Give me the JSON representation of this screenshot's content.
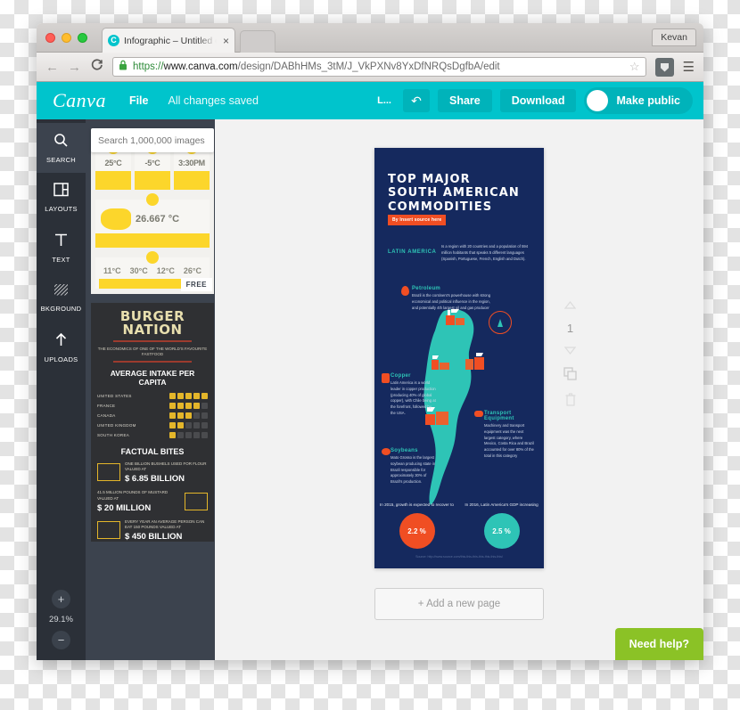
{
  "browser": {
    "tab": {
      "title": "Infographic – Untitled desi",
      "close": "×",
      "favicon_letter": "C"
    },
    "user": "Kevan",
    "nav": {
      "back": "←",
      "forward": "→",
      "reload": "C"
    },
    "url": {
      "scheme": "https://",
      "host": "www.canva.com",
      "path": "/design/DABhHMs_3tM/J_VkPXNv8YxDfNRQsDgfbA/edit",
      "full": "https://www.canva.com/design/DABhHMs_3tM/J_VkPXNv8YxDfNRQsDgfbA/edit"
    },
    "star": "☆",
    "menu": "☰"
  },
  "topbar": {
    "logo": "Canva",
    "file_label": "File",
    "saved_label": "All changes saved",
    "layout_label": "L...",
    "undo_label": "↶",
    "share_label": "Share",
    "download_label": "Download",
    "make_public_label": "Make public",
    "accent_color": "#00c4cc"
  },
  "rail": {
    "items": [
      {
        "label": "SEARCH",
        "icon": "search-icon",
        "active": true
      },
      {
        "label": "LAYOUTS",
        "icon": "layouts-icon",
        "active": false
      },
      {
        "label": "TEXT",
        "icon": "text-icon",
        "active": false
      },
      {
        "label": "BKGROUND",
        "icon": "background-icon",
        "active": false
      },
      {
        "label": "UPLOADS",
        "icon": "uploads-icon",
        "active": false
      }
    ],
    "zoom_in": "+",
    "zoom_out": "−",
    "zoom_value": "29.1%"
  },
  "panel": {
    "search_placeholder": "Search 1,000,000 images",
    "search_value": "",
    "free_badge": "FREE",
    "thumb_weather": {
      "cards": [
        {
          "temp": "25°C"
        },
        {
          "temp": "-5°C"
        },
        {
          "temp": "3:30PM"
        }
      ],
      "big_temp": "26.667 °C",
      "bottom_temps": [
        "11°C",
        "30°C",
        "12°C",
        "26°C"
      ]
    },
    "thumb_burger": {
      "title_line1": "BURGER",
      "title_line2": "NATION",
      "subtitle": "THE ECONOMICS OF ONE OF THE WORLD'S FAVOURITE FASTFOOD",
      "section1": "AVERAGE INTAKE PER CAPITA",
      "countries": [
        {
          "name": "UNITED STATES",
          "filled": 5
        },
        {
          "name": "FRANCE",
          "filled": 4
        },
        {
          "name": "CANADA",
          "filled": 3
        },
        {
          "name": "UNITED KINGDOM",
          "filled": 2
        },
        {
          "name": "SOUTH KOREA",
          "filled": 1
        }
      ],
      "section2": "FACTUAL BITES",
      "facts": [
        {
          "small": "ONE BILLION BUSHELS USED FOR FLOUR VALUED AT",
          "big": "$ 6.85 BILLION"
        },
        {
          "small": "41.5 MILLION POUNDS OF MUSTARD VALUED AT",
          "big": "$ 20 MILLION"
        },
        {
          "small": "EVERY YEAR AN AVERAGE PERSON CAN EAT 150 POUNDS VALUED AT",
          "big": "$ 450 BILLION"
        }
      ]
    }
  },
  "design": {
    "title_line1": "TOP MAJOR",
    "title_line2": "SOUTH AMERICAN",
    "title_line3": "COMMODITIES",
    "source_badge": "By Insert source here",
    "latin_america_heading": "LATIN AMERICA",
    "latin_america_body": "Is a region with 20 countries and a population of 594 million habitants that speaks 5 different languages (Spanish, Portuguese, French, English and Dutch).",
    "sections": [
      {
        "heading": "Petroleum",
        "body": "Brazil is the continent's powerhouse with strong economical and political influence in the region, and potentially 4th largest oil and gas producer",
        "highlight": "4th largest"
      },
      {
        "heading": "Copper",
        "body": "Latin America is a world leader in copper production (producing 40% of global copper), with Chile being at the forefront, followed by the USA.",
        "highlight": "40%"
      },
      {
        "heading": "Transport Equipment",
        "body": "Machinery and transport equipment was the next largest category, where Mexico, Costa Rica and Brazil accounted for over 80% of the total in this category",
        "highlight": "80%"
      },
      {
        "heading": "Soybeans",
        "body": "Mato Grosso is the largest soybean producing state in Brazil responsible for approximately 30% of Brazil's production.",
        "highlight": "30%"
      }
    ],
    "stats": [
      {
        "caption": "In 2015, growth is expected to recover to",
        "value": "2.2 %",
        "color": "#f04e23",
        "year": "2015"
      },
      {
        "caption": "In 2016, Latin America's GDP increasing",
        "value": "2.5 %",
        "color": "#2ec4b6",
        "year": "2016"
      }
    ],
    "footer": "Source: http://www.source.com/this-this-this-this-this-this-this/",
    "bg_color": "#15295e"
  },
  "page_controls": {
    "up": "▲",
    "page_number": "1",
    "down": "▼",
    "duplicate_icon": "duplicate-icon",
    "delete_icon": "trash-icon"
  },
  "canvas": {
    "add_page_label": "+ Add a new page"
  },
  "help": {
    "label": "Need help?",
    "color": "#8bc226"
  }
}
